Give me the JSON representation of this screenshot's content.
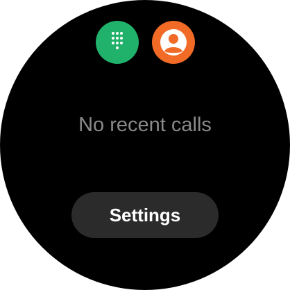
{
  "top_actions": [
    {
      "icon": "dialpad-icon",
      "color": "#20b26b"
    },
    {
      "icon": "contact-person-icon",
      "color": "#f16b26"
    }
  ],
  "main": {
    "empty_message": "No recent calls"
  },
  "settings_button": {
    "label": "Settings",
    "color": "#2b2b2b"
  },
  "background_color": "#000000"
}
